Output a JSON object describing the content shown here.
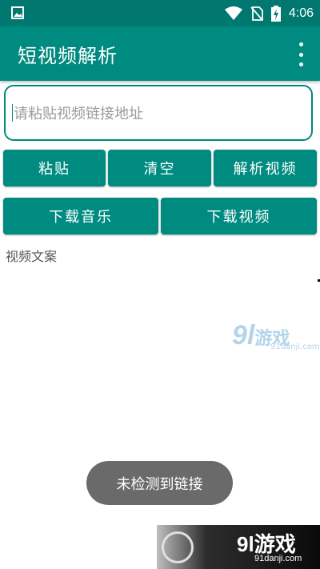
{
  "status_bar": {
    "time": "4:06",
    "icons": [
      "image-icon",
      "wifi-icon",
      "no-sim-icon",
      "battery-charging-icon"
    ]
  },
  "app_bar": {
    "title": "短视频解析",
    "menu_icon": "more-vert-icon"
  },
  "url_input": {
    "placeholder": "请粘贴视频链接地址",
    "value": ""
  },
  "buttons": {
    "paste": "粘贴",
    "clear": "清空",
    "parse": "解析视频",
    "download_music": "下载音乐",
    "download_video": "下载视频"
  },
  "caption_label": "视频文案",
  "toast": "未检测到链接",
  "watermark": {
    "brand_num": "9l",
    "brand_cn": "游戏",
    "domain": "91danji.com"
  },
  "colors": {
    "status_bar": "#00786f",
    "primary": "#008b80",
    "toast_bg": "#6a6a6a"
  }
}
